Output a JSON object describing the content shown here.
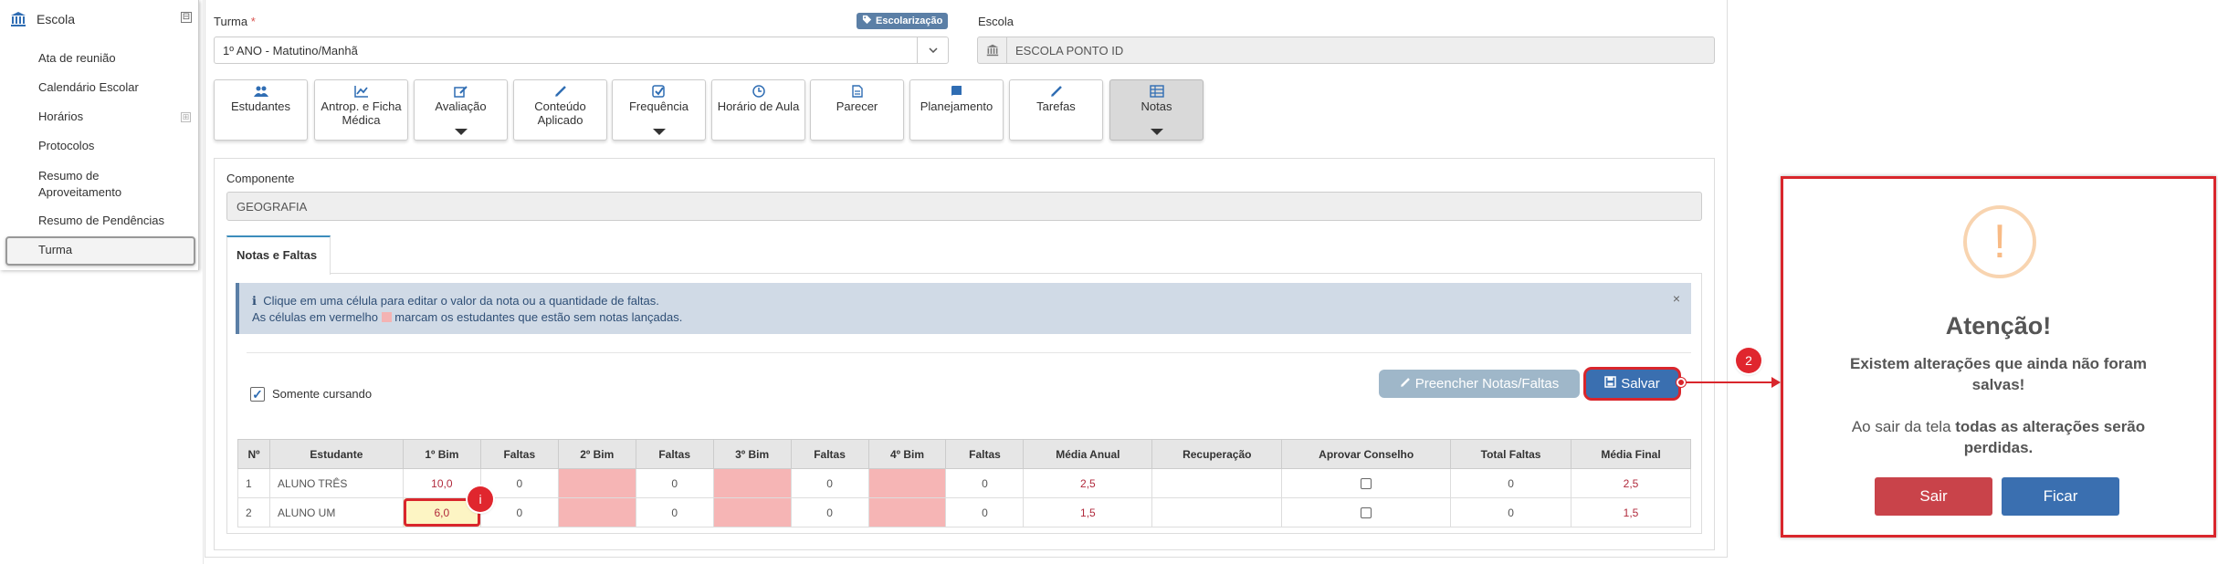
{
  "sidebar": {
    "title": "Escola",
    "collapse_symbol": "⊟",
    "expand_symbol": "⊞",
    "items": [
      {
        "label": "Ata de reunião"
      },
      {
        "label": "Calendário Escolar"
      },
      {
        "label": "Horários"
      },
      {
        "label": "Protocolos"
      },
      {
        "label": "Resumo de Aproveitamento"
      },
      {
        "label": "Resumo de Pendências"
      },
      {
        "label": "Turma"
      }
    ]
  },
  "form": {
    "turma_label": "Turma",
    "required_mark": "*",
    "turma_value": "1º ANO - Matutino/Manhã",
    "badge": "Escolarização",
    "escola_label": "Escola",
    "escola_value": "ESCOLA PONTO ID"
  },
  "toolbar": [
    {
      "label": "Estudantes",
      "icon": "users-icon"
    },
    {
      "label": "Antrop. e Ficha Médica",
      "icon": "chart-icon"
    },
    {
      "label": "Avaliação",
      "icon": "edit-icon"
    },
    {
      "label": "Conteúdo Aplicado",
      "icon": "pencil-icon"
    },
    {
      "label": "Frequência",
      "icon": "check-square-icon"
    },
    {
      "label": "Horário de Aula",
      "icon": "clock-icon"
    },
    {
      "label": "Parecer",
      "icon": "document-icon"
    },
    {
      "label": "Planejamento",
      "icon": "book-icon"
    },
    {
      "label": "Tarefas",
      "icon": "pencil-icon"
    },
    {
      "label": "Notas",
      "icon": "table-icon"
    }
  ],
  "componente": {
    "label": "Componente",
    "value": "GEOGRAFIA"
  },
  "tab": {
    "label": "Notas e Faltas"
  },
  "alert": {
    "line1": "Clique em uma célula para editar o valor da nota ou a quantidade de faltas.",
    "line2a": "As células em vermelho",
    "line2b": "marcam os estudantes que estão sem notas lançadas.",
    "close": "×"
  },
  "filter": {
    "label": "Somente cursando",
    "checked": true
  },
  "buttons": {
    "fill": "Preencher Notas/Faltas",
    "save": "Salvar"
  },
  "table": {
    "headers": [
      "Nº",
      "Estudante",
      "1º Bim",
      "Faltas",
      "2º Bim",
      "Faltas",
      "3º Bim",
      "Faltas",
      "4º Bim",
      "Faltas",
      "Média Anual",
      "Recuperação",
      "Aprovar Conselho",
      "Total Faltas",
      "Média Final"
    ],
    "rows": [
      {
        "n": "1",
        "student": "ALUNO TRÊS",
        "b1": "10,0",
        "f1": "0",
        "f2": "0",
        "f3": "0",
        "f4": "0",
        "media_anual": "2,5",
        "recuperacao": "",
        "total_faltas": "0",
        "media_final": "2,5"
      },
      {
        "n": "2",
        "student": "ALUNO UM",
        "b1": "6,0",
        "f1": "0",
        "f2": "0",
        "f3": "0",
        "f4": "0",
        "media_anual": "1,5",
        "recuperacao": "",
        "total_faltas": "0",
        "media_final": "1,5"
      }
    ]
  },
  "markers": {
    "m1": "i",
    "m2": "2"
  },
  "modal": {
    "icon": "!",
    "title": "Atenção!",
    "message": "Existem alterações que ainda não foram salvas!",
    "info_prefix": "Ao sair da tela ",
    "info_bold": "todas as alterações serão perdidas.",
    "exit_label": "Sair",
    "stay_label": "Ficar",
    "exit_color": "#c9434a",
    "stay_color": "#3a6fb0"
  }
}
